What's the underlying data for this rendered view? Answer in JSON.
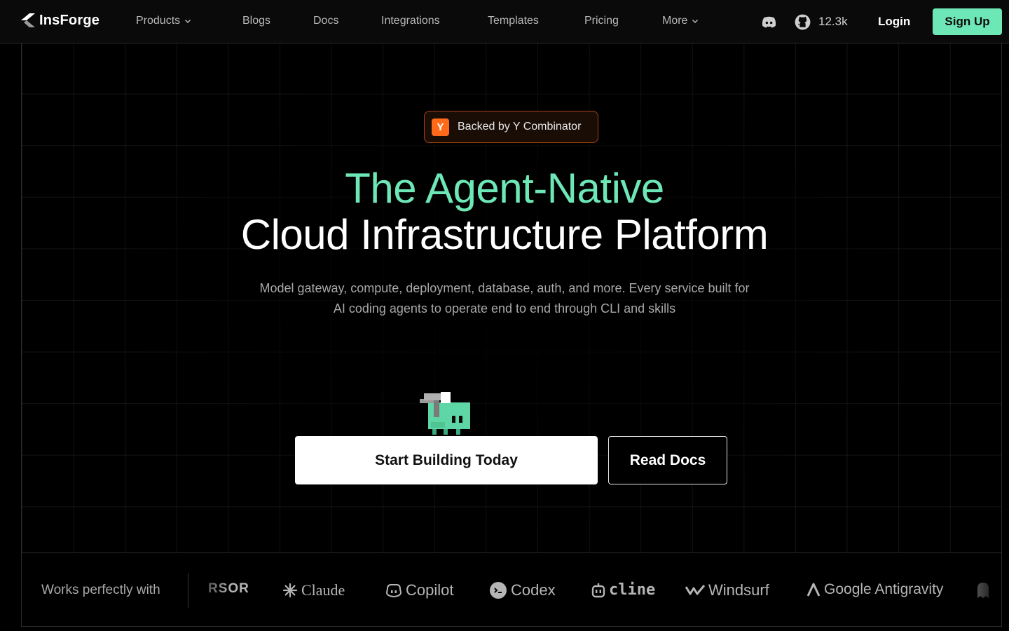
{
  "nav": {
    "brand": "InsForge",
    "links": [
      {
        "label": "Products",
        "dropdown": true
      },
      {
        "label": "Blogs"
      },
      {
        "label": "Docs"
      },
      {
        "label": "Integrations"
      },
      {
        "label": "Templates"
      },
      {
        "label": "Pricing"
      },
      {
        "label": "More",
        "dropdown": true
      }
    ],
    "icons": [
      "discord-icon",
      "github-icon"
    ],
    "github_stars": "12.3k",
    "login_label": "Login",
    "signup_label": "Sign Up"
  },
  "hero": {
    "badge_letter": "Y",
    "badge_text": "Backed by Y Combinator",
    "title_line1": "The Agent-Native",
    "title_line2": "Cloud Infrastructure Platform",
    "subtitle_line1": "Model gateway, compute, deployment, database, auth, and more. Every service built for",
    "subtitle_line2": "AI coding agents to operate end to end through CLI and skills",
    "primary_cta": "Start Building Today",
    "secondary_cta": "Read Docs"
  },
  "partners": {
    "label": "Works perfectly with",
    "items": [
      {
        "name": "RSOR"
      },
      {
        "name": "Claude"
      },
      {
        "name": "Copilot"
      },
      {
        "name": "Codex"
      },
      {
        "name": "cline"
      },
      {
        "name": "Windsurf"
      },
      {
        "name": "Google Antigravity"
      }
    ]
  },
  "colors": {
    "accent": "#6ee7b7",
    "background": "#000000",
    "yc_orange": "#ff6a1a",
    "badge_border": "#a84214"
  }
}
